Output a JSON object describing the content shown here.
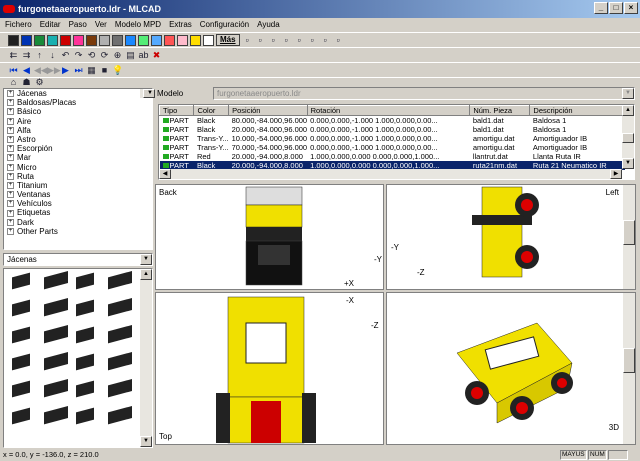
{
  "window": {
    "title": "furgonetaaeropuerto.ldr - MLCAD"
  },
  "menu": [
    "Fichero",
    "Editar",
    "Paso",
    "Ver",
    "Modelo MPD",
    "Extras",
    "Configuración",
    "Ayuda"
  ],
  "toolbar": {
    "colors": [
      "#202020",
      "#0033b3",
      "#1a8a3a",
      "#1ab0b0",
      "#cc0000",
      "#ff3399",
      "#7a3a0a",
      "#b0b0b0",
      "#707070",
      "#1a88ff",
      "#55ee77",
      "#55aaff",
      "#ff5555",
      "#ffbbcc",
      "#ffdd00",
      "#ffffff"
    ],
    "more_label": "Más"
  },
  "parts_tree": {
    "items": [
      "Jácenas",
      "Baldosas/Placas",
      "Básico",
      "Aire",
      "Alfa",
      "Astro",
      "Escorpión",
      "Mar",
      "Micro",
      "Ruta",
      "Titanium",
      "Ventanas",
      "Vehículos",
      "Etiquetas",
      "Dark",
      "Other Parts"
    ]
  },
  "category_select": {
    "value": "Jácenas"
  },
  "model": {
    "label": "Modelo",
    "value": "furgonetaaeropuerto.ldr"
  },
  "table": {
    "headers": [
      "Tipo",
      "Color",
      "Posición",
      "Rotación",
      "Núm. Pieza",
      "Descripción"
    ],
    "rows": [
      [
        "PART",
        "Black",
        "80.000,-84.000,96.000",
        "0.000,0.000,-1.000 1.000,0.000,0.00...",
        "bald1.dat",
        "Baldosa 1"
      ],
      [
        "PART",
        "Black",
        "20.000,-84.000,96.000",
        "0.000,0.000,-1.000 1.000,0.000,0.00...",
        "bald1.dat",
        "Baldosa 1"
      ],
      [
        "PART",
        "Trans-Y...",
        "10.000,-54.000,96.000",
        "0.000,0.000,-1.000 1.000,0.000,0.00...",
        "amortigu.dat",
        "Amortiguador    IB"
      ],
      [
        "PART",
        "Trans-Y...",
        "70.000,-54.000,96.000",
        "0.000,0.000,-1.000 1.000,0.000,0.00...",
        "amortigu.dat",
        "Amortiguador    IB"
      ],
      [
        "PART",
        "Red",
        "20.000,-94.000,8.000",
        "1.000,0.000,0.000 0.000,0.000,1.000...",
        "llantrut.dat",
        "Llanta Ruta    IR"
      ],
      [
        "PART",
        "Black",
        "20.000,-94.000,8.000",
        "1.000,0.000,0.000 0.000,0.000,1.000...",
        "ruta21nm.dat",
        "Ruta 21 Neumatico    IR"
      ]
    ],
    "selected_row": 5
  },
  "viewports": {
    "back": "Back",
    "left": "Left",
    "top": "Top",
    "3d": "3D",
    "axes": {
      "back_y": "-Y",
      "back_x": "+X",
      "left_y": "-Y",
      "left_z": "-Z",
      "top_x": "-X",
      "top_z": "-Z"
    }
  },
  "status": {
    "coords": "x = 0.0, y = -136.0, z = 210.0",
    "caps": "MAYUS",
    "num": "NUM"
  }
}
